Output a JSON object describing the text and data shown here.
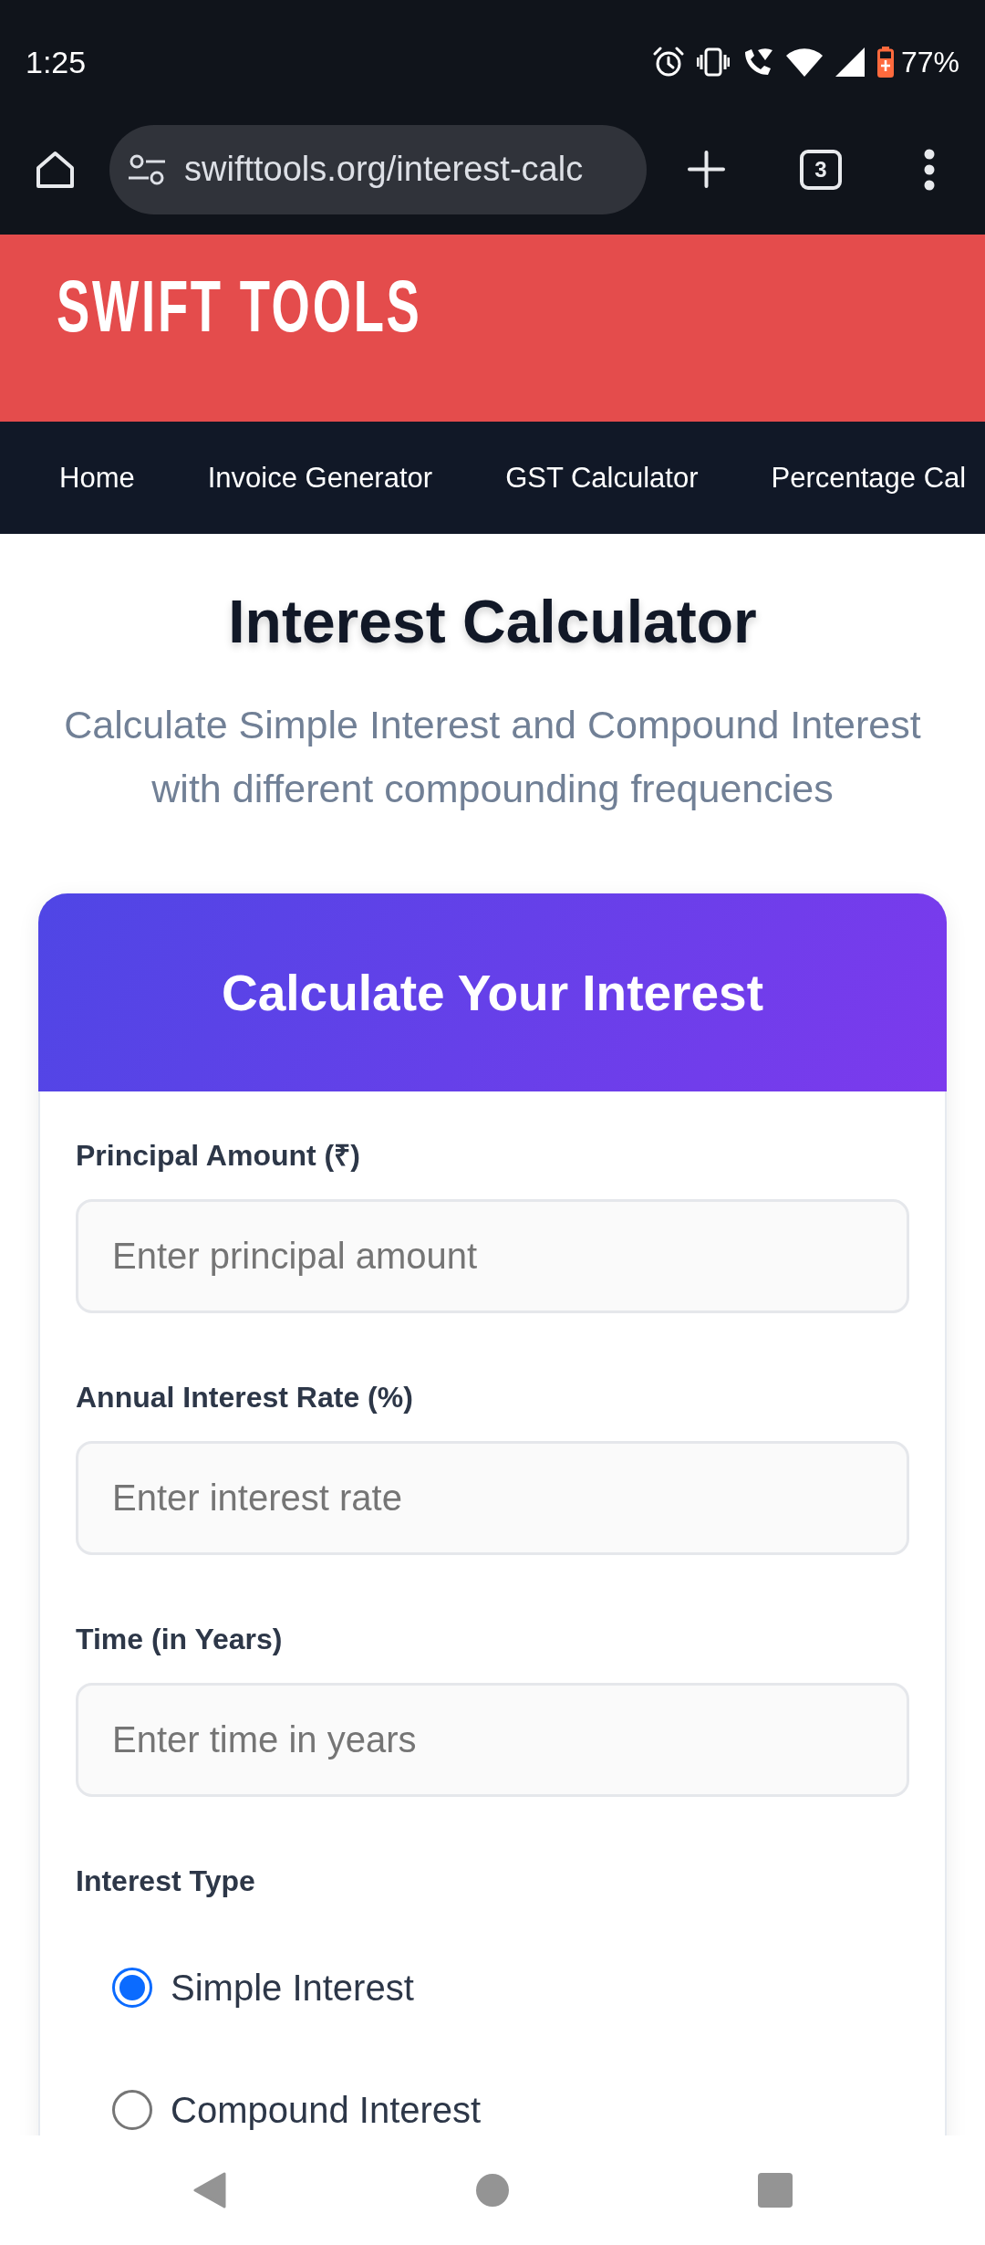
{
  "status_bar": {
    "time": "1:25",
    "battery": "77%"
  },
  "browser": {
    "url": "swifttools.org/interest-calc",
    "tab_count": "3"
  },
  "site_header": {
    "logo": "SWIFT TOOLS"
  },
  "nav": [
    "Home",
    "Invoice Generator",
    "GST Calculator",
    "Percentage Cal"
  ],
  "page": {
    "title": "Interest Calculator",
    "subtitle": "Calculate Simple Interest and Compound Interest with different compounding frequencies"
  },
  "card": {
    "title": "Calculate Your Interest",
    "fields": [
      {
        "label": "Principal Amount (₹)",
        "placeholder": "Enter principal amount"
      },
      {
        "label": "Annual Interest Rate (%)",
        "placeholder": "Enter interest rate"
      },
      {
        "label": "Time (in Years)",
        "placeholder": "Enter time in years"
      }
    ],
    "interest_type": {
      "label": "Interest Type",
      "options": [
        {
          "label": "Simple Interest",
          "selected": true
        },
        {
          "label": "Compound Interest",
          "selected": false
        }
      ]
    }
  }
}
